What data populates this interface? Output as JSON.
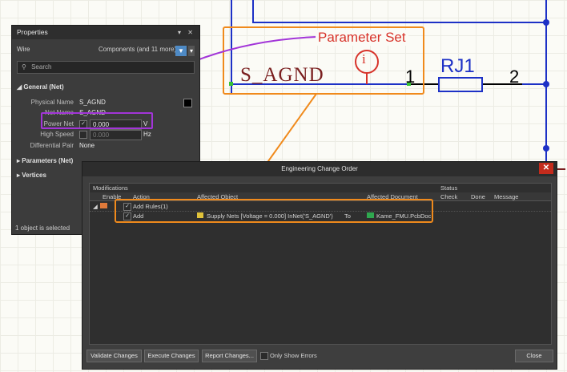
{
  "schematic": {
    "net_label": "S_AGND",
    "pin1": "1",
    "pin2": "2",
    "designator": "RJ1",
    "callout_label": "Parameter Set",
    "callout_glyph": "i"
  },
  "properties_panel": {
    "title": "Properties",
    "title_buttons": "▾ ✕",
    "object_type": "Wire",
    "filter_text": "Components (and 11 more)",
    "search_placeholder": "Search",
    "general_section": "General (Net)",
    "rows": [
      {
        "label": "Physical Name",
        "value": "S_AGND"
      },
      {
        "label": "Net Name",
        "value": "S_AGND"
      },
      {
        "label": "Power Net",
        "value": "0.000",
        "unit": "V"
      },
      {
        "label": "High Speed",
        "value": "0.000",
        "unit": "Hz"
      },
      {
        "label": "Differential Pair",
        "value": "None"
      }
    ],
    "parameters_section": "Parameters (Net)",
    "vertices_section": "Vertices",
    "status": "1 object is selected"
  },
  "eco_dialog": {
    "title": "Engineering Change Order",
    "close_glyph": "✕",
    "modifications_label": "Modifications",
    "status_label": "Status",
    "columns": [
      "Enable",
      "Action",
      "Affected Object",
      "Affected Document",
      "Check",
      "Done",
      "Message"
    ],
    "group_row": {
      "action": "Add Rules(1)"
    },
    "rows": [
      {
        "action": "Add",
        "object": "Supply Nets [Voltage = 0.000] InNet('S_AGND')",
        "to": "To",
        "document": "Kame_FMU.PcbDoc"
      }
    ],
    "buttons": {
      "validate": "Validate Changes",
      "execute": "Execute Changes",
      "report": "Report Changes...",
      "only_errors": "Only Show Errors",
      "close": "Close"
    }
  },
  "colors": {
    "callout_orange": "#f08a1c",
    "callout_purple": "#a235d8",
    "wire_blue": "#1d31c6",
    "net_label_red": "#7a1f1f",
    "filter_blue": "#4e8ac5"
  }
}
